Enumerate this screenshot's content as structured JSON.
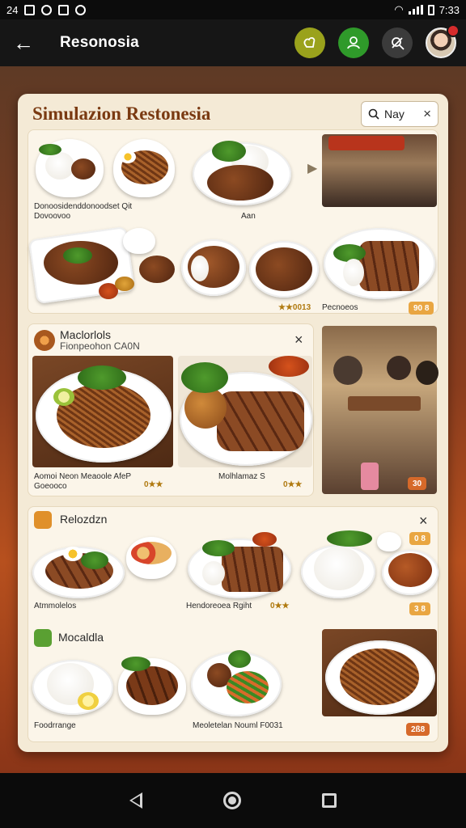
{
  "status_bar": {
    "time_left": "24",
    "time_right": "7:33"
  },
  "app_bar": {
    "back_glyph": "←",
    "title": "Resonosia"
  },
  "main": {
    "title": "Simulazion Restonesia",
    "search": {
      "value": "Nay",
      "clear": "×"
    },
    "section1": {
      "label_1": "Donoosidenddonoodset Qit",
      "label_2": "Dovoovoo",
      "label_3": "Aan",
      "rating_1": "★★0013",
      "label_4": "Pecnoeos",
      "pill_1": "90 8"
    },
    "section2": {
      "title": "Maclorlols",
      "subtitle": "Fionpeohon  CA0N",
      "close": "×",
      "label_1": "Aomoi Neon Meaoole AfeP",
      "label_2": "Goeooco",
      "rating_1": "0★★",
      "label_3": "Molhlamaz S",
      "rating_2": "0★★",
      "pill_1": "30"
    },
    "section3": {
      "title": "Relozdzn",
      "close": "×",
      "label_1": "Atmmolelos",
      "label_2": "Hendoreoea Rgiht",
      "rating_1": "0★★",
      "pill_1": "0 8",
      "pill_2": "3 8",
      "subtitle": "Mocaldla",
      "label_3": "Foodrrange",
      "label_4": "Meoletelan Nouml F0031",
      "pill_3": "2ß8"
    }
  }
}
